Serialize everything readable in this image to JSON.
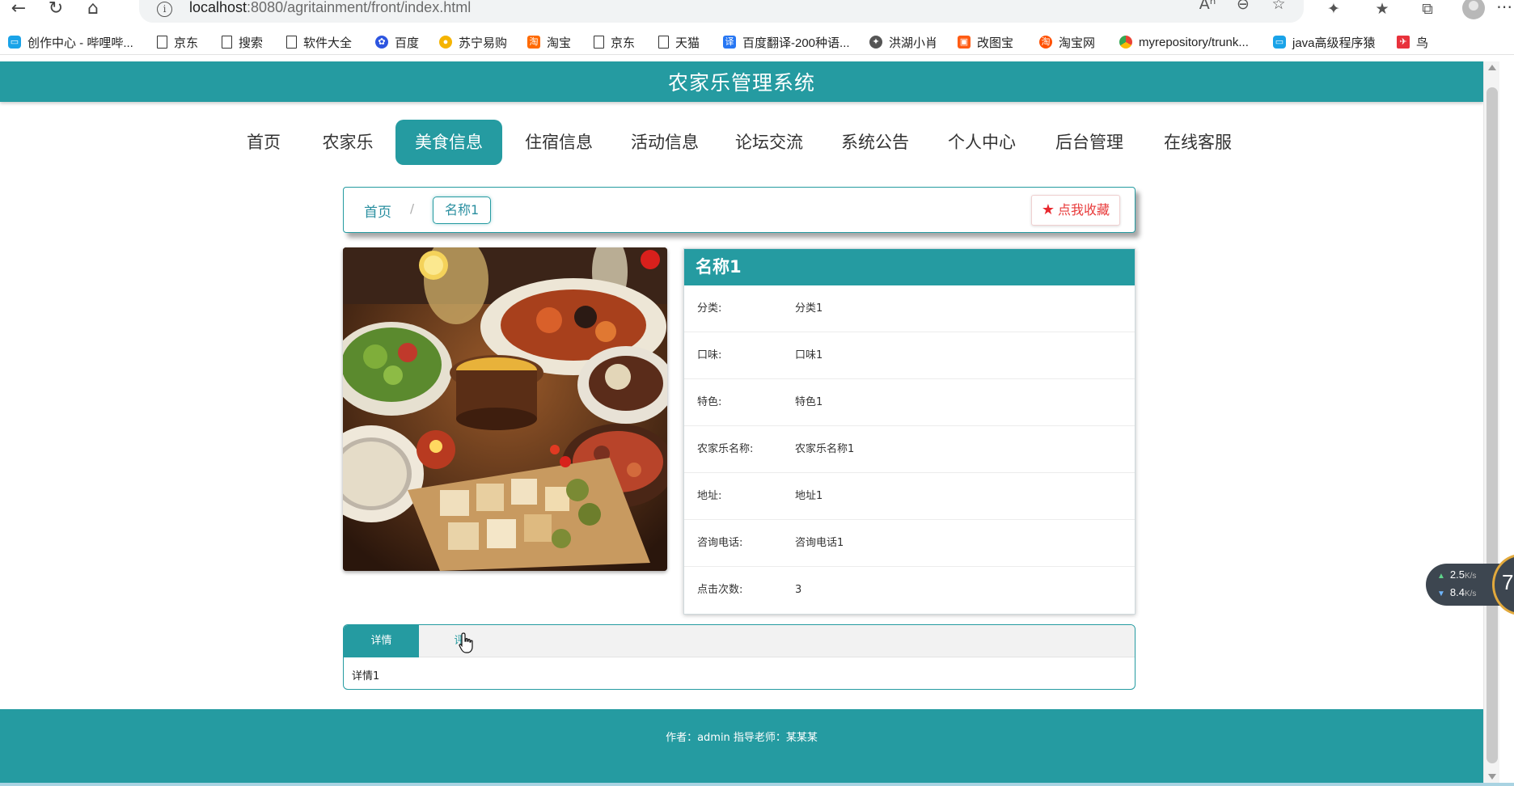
{
  "browser": {
    "url_host": "localhost",
    "url_path": ":8080/agritainment/front/index.html",
    "bookmarks": [
      {
        "label": "创作中心 - 哔哩哔...",
        "icon": "bilibili-icon"
      },
      {
        "label": "京东",
        "icon": "page-icon"
      },
      {
        "label": "搜索",
        "icon": "page-icon"
      },
      {
        "label": "软件大全",
        "icon": "page-icon"
      },
      {
        "label": "百度",
        "icon": "baidu-icon"
      },
      {
        "label": "苏宁易购",
        "icon": "suning-icon"
      },
      {
        "label": "淘宝",
        "icon": "taobao-icon"
      },
      {
        "label": "京东",
        "icon": "page-icon"
      },
      {
        "label": "天猫",
        "icon": "page-icon"
      },
      {
        "label": "百度翻译-200种语...",
        "icon": "translate-icon"
      },
      {
        "label": "洪湖小肖",
        "icon": "hh-icon"
      },
      {
        "label": "改图宝",
        "icon": "gaitubao-icon"
      },
      {
        "label": "淘宝网",
        "icon": "taobao-icon"
      },
      {
        "label": "myrepository/trunk...",
        "icon": "chrome-icon"
      },
      {
        "label": "java高级程序猿",
        "icon": "bilibili-icon"
      },
      {
        "label": "鸟",
        "icon": "bird-icon"
      }
    ]
  },
  "site": {
    "title": "农家乐管理系统",
    "accent_color": "#259ba1"
  },
  "nav": {
    "items": [
      {
        "label": "首页"
      },
      {
        "label": "农家乐"
      },
      {
        "label": "美食信息",
        "active": true
      },
      {
        "label": "住宿信息"
      },
      {
        "label": "活动信息"
      },
      {
        "label": "论坛交流"
      },
      {
        "label": "系统公告"
      },
      {
        "label": "个人中心"
      },
      {
        "label": "后台管理"
      },
      {
        "label": "在线客服"
      }
    ]
  },
  "breadcrumb": {
    "home": "首页",
    "separator": "/",
    "current": "名称1"
  },
  "favorite": {
    "label": "点我收藏"
  },
  "detail": {
    "title": "名称1",
    "fields": [
      {
        "key": "分类:",
        "value": "分类1"
      },
      {
        "key": "口味:",
        "value": "口味1"
      },
      {
        "key": "特色:",
        "value": "特色1"
      },
      {
        "key": "农家乐名称:",
        "value": "农家乐名称1"
      },
      {
        "key": "地址:",
        "value": "地址1"
      },
      {
        "key": "咨询电话:",
        "value": "咨询电话1"
      },
      {
        "key": "点击次数:",
        "value": "3"
      }
    ]
  },
  "tabs": {
    "items": [
      {
        "label": "详情",
        "active": true
      },
      {
        "label": "评"
      }
    ],
    "content": "详情1"
  },
  "footer": {
    "text": "作者：admin 指导老师：某某某"
  },
  "network": {
    "up": "2.5",
    "down": "8.4",
    "unit": "K/s",
    "badge": "7"
  }
}
